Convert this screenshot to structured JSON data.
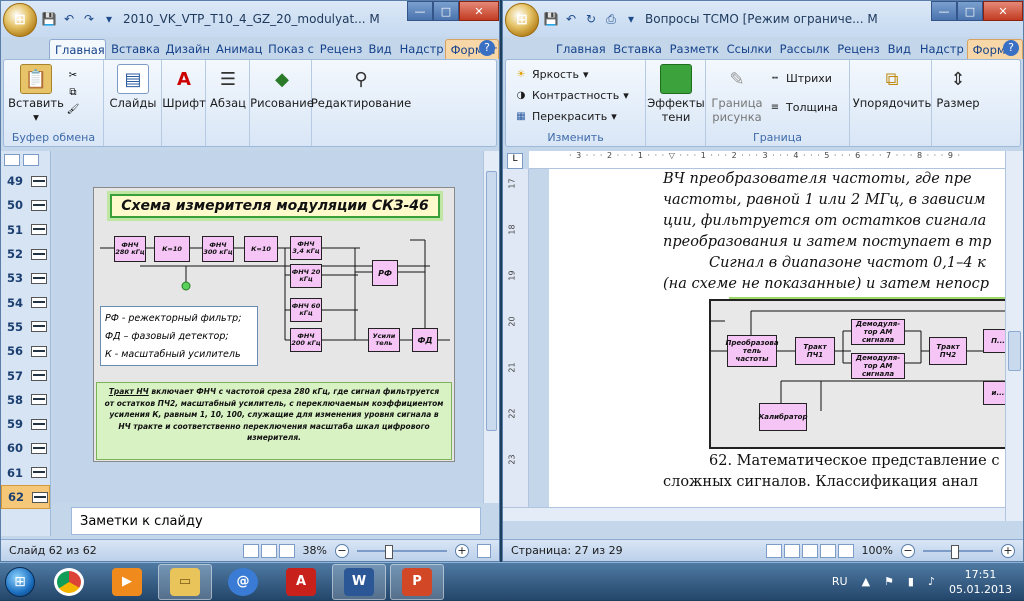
{
  "powerpoint": {
    "title": "2010_VK_VTP_T10_4_GZ_20_modulyat... M",
    "tabs": [
      "Главная",
      "Вставка",
      "Дизайн",
      "Анимац",
      "Показ с",
      "Реценз",
      "Вид",
      "Надстр",
      "Формат"
    ],
    "groups": {
      "clipboard": {
        "paste": "Вставить",
        "label": "Буфер обмена"
      },
      "slides": "Слайды",
      "font": "Шрифт",
      "paragraph": "Абзац",
      "drawing": "Рисование",
      "editing": "Редактирование"
    },
    "thumbnails": [
      "49",
      "50",
      "51",
      "52",
      "53",
      "54",
      "55",
      "56",
      "57",
      "58",
      "59",
      "60",
      "61",
      "62"
    ],
    "selected_thumbnail": "62",
    "slide": {
      "title": "Схема измерителя  модуляции СКЗ-46",
      "blocks": {
        "fnch280": "ФНЧ 280 кГц",
        "k10a": "К=10",
        "fnch300": "ФНЧ 300 кГц",
        "k10b": "К=10",
        "fnch34": "ФНЧ 3,4 кГц",
        "fnch20": "ФНЧ 20 кГц",
        "fnch60": "ФНЧ 60 кГц",
        "fnch200": "ФНЧ 200 кГц",
        "rf": "РФ",
        "amp": "Усили тель",
        "fd": "ФД"
      },
      "legend": [
        "РФ - режекторный фильтр;",
        "ФД – фазовый детектор;",
        "К - масштабный усилитель"
      ],
      "description_underlined": "Тракт НЧ",
      "description": " включает ФНЧ с частотой среза 280 кГц, где сигнал фильтруется от остатков ПЧ2,  масштабный усилитель, с переключаемым коэффициентом усиления К, равным 1,  10, 100, служащие для изменения уровня сигнала в НЧ тракте и соответственно переключения масштаба шкал цифрового измерителя."
    },
    "notes_placeholder": "Заметки к слайду",
    "status": {
      "slide_info": "Слайд 62 из 62",
      "zoom": "38%"
    }
  },
  "word": {
    "title": "Вопросы ТСМО [Режим ограниче... M",
    "tabs": [
      "Главная",
      "Вставка",
      "Разметк",
      "Ссылки",
      "Рассылк",
      "Реценз",
      "Вид",
      "Надстр",
      "Формат"
    ],
    "groups": {
      "adjust": {
        "brightness": "Яркость",
        "contrast": "Контрастность",
        "recolor": "Перекрасить",
        "label": "Изменить"
      },
      "effects": "Эффекты тени",
      "border": {
        "picture_border": "Граница рисунка",
        "dashes": "Штрихи",
        "weight": "Толщина",
        "label": "Граница"
      },
      "arrange": "Упорядочить",
      "size": "Размер"
    },
    "ruler_v": [
      "17",
      "18",
      "19",
      "20",
      "21",
      "22",
      "23"
    ],
    "doc_lines": [
      "ВЧ преобразователя частоты, где пре",
      "частоты, равной 1 или 2 МГц, в зависим",
      "ции, фильтруется от остатков сигнала",
      "преобразования и затем поступает в тр"
    ],
    "doc_line_indent": "Сигнал в диапазоне частот 0,1–4 к",
    "doc_line_cont": "(на  схеме не показанные) и затем непоср",
    "diagram_blocks": {
      "preob": "Преобразова тель частоты",
      "pch1": "Тракт ПЧ1",
      "demod1": "Демодуля- тор АМ сигнала",
      "demod2": "Демодуля- тор АМ сигнала",
      "pch2": "Тракт ПЧ2",
      "calib": "Калибратор",
      "right1": "П...",
      "right2": "и..."
    },
    "doc_after": [
      "62. Математическое представление с",
      "сложных сигналов. Классификация анал"
    ],
    "status": {
      "page_info": "Страница: 27 из 29",
      "zoom": "100%"
    }
  },
  "taskbar": {
    "language": "RU",
    "time": "17:51",
    "date": "05.01.2013"
  }
}
